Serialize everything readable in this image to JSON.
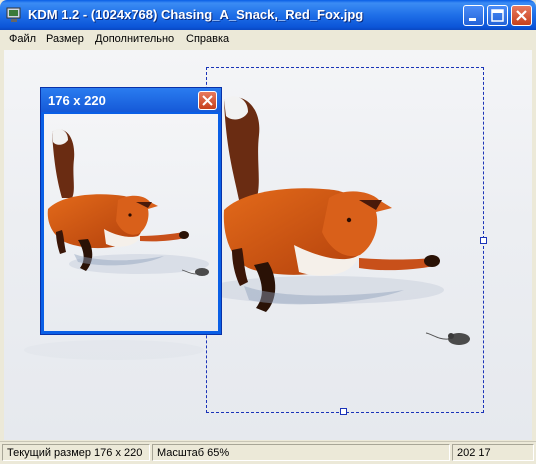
{
  "window": {
    "title": "KDM 1.2 - (1024x768) Chasing_A_Snack,_Red_Fox.jpg",
    "icon": "app-monitor-icon"
  },
  "titlebar_buttons": {
    "minimize": "minimize-icon",
    "maximize": "maximize-icon",
    "close": "close-icon"
  },
  "menu": {
    "items": [
      {
        "label": "Файл"
      },
      {
        "label": "Размер"
      },
      {
        "label": "Дополнительно"
      },
      {
        "label": "Справка"
      }
    ]
  },
  "image": {
    "subject": "Red fox chasing a mouse on snow"
  },
  "preview": {
    "title": "176 x 220"
  },
  "status": {
    "current_size": "Текущий размер 176 x 220",
    "scale": "Масштаб 65%",
    "coords": "202 17"
  }
}
